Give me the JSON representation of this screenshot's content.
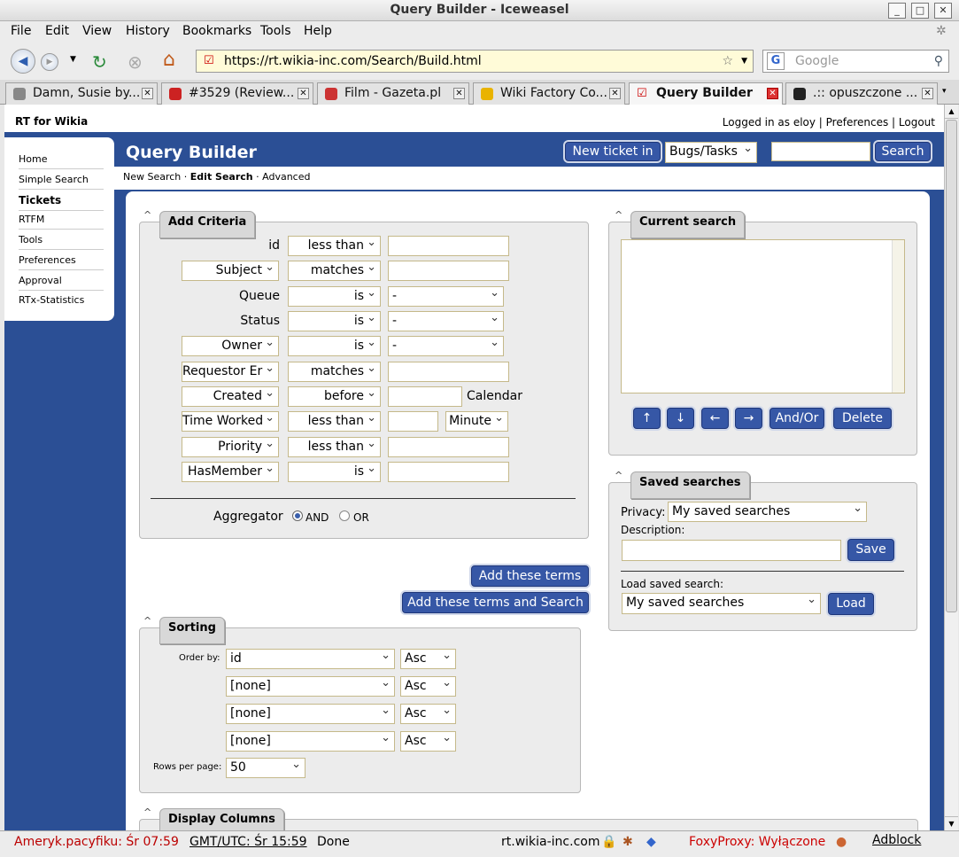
{
  "window": {
    "title": "Query Builder - Iceweasel"
  },
  "menu": [
    "File",
    "Edit",
    "View",
    "History",
    "Bookmarks",
    "Tools",
    "Help"
  ],
  "nav": {
    "url": "https://rt.wikia-inc.com/Search/Build.html",
    "search_placeholder": "Google"
  },
  "tabs": [
    {
      "label": "Damn, Susie by..."
    },
    {
      "label": "#3529 (Review..."
    },
    {
      "label": "Film - Gazeta.pl"
    },
    {
      "label": "Wiki Factory Co..."
    },
    {
      "label": "Query Builder"
    },
    {
      "label": ".:: opuszczone ..."
    }
  ],
  "header": {
    "site": "RT for Wikia",
    "logged_in": "Logged in as eloy",
    "preferences": "Preferences",
    "logout": "Logout",
    "page_title": "Query Builder",
    "new_ticket": "New ticket in",
    "queue_select": "Bugs/Tasks",
    "search_btn": "Search"
  },
  "sidebar": [
    "Home",
    "Simple Search",
    "Tickets",
    "RTFM",
    "Tools",
    "Preferences",
    "Approval",
    "RTx-Statistics"
  ],
  "subnav": {
    "new": "New Search",
    "edit": "Edit Search",
    "advanced": "Advanced"
  },
  "criteria": {
    "title": "Add Criteria",
    "rows": [
      {
        "field": "id",
        "op": "less than",
        "value": ""
      },
      {
        "field": "Subject",
        "op": "matches",
        "value": ""
      },
      {
        "field": "Queue",
        "op": "is",
        "value": "-"
      },
      {
        "field": "Status",
        "op": "is",
        "value": "-"
      },
      {
        "field": "Owner",
        "op": "is",
        "value": "-"
      },
      {
        "field": "Requestor Er",
        "op": "matches",
        "value": ""
      },
      {
        "field": "Created",
        "op": "before",
        "value": "",
        "extra": "Calendar"
      },
      {
        "field": "Time Worked",
        "op": "less than",
        "value": "",
        "extra": "Minute"
      },
      {
        "field": "Priority",
        "op": "less than",
        "value": ""
      },
      {
        "field": "HasMember",
        "op": "is",
        "value": ""
      }
    ],
    "aggregator": "Aggregator",
    "and": "AND",
    "or": "OR",
    "add_terms": "Add these terms",
    "add_terms_search": "Add these terms and Search"
  },
  "current": {
    "title": "Current search",
    "up": "↑",
    "down": "↓",
    "left": "←",
    "right": "→",
    "andor": "And/Or",
    "delete": "Delete"
  },
  "saved": {
    "title": "Saved searches",
    "privacy_label": "Privacy:",
    "privacy": "My saved searches",
    "description": "Description:",
    "save": "Save",
    "load_label": "Load saved search:",
    "load_select": "My saved searches",
    "load": "Load"
  },
  "sorting": {
    "title": "Sorting",
    "order_by": "Order by:",
    "rows": [
      {
        "field": "id",
        "dir": "Asc"
      },
      {
        "field": "[none]",
        "dir": "Asc"
      },
      {
        "field": "[none]",
        "dir": "Asc"
      },
      {
        "field": "[none]",
        "dir": "Asc"
      }
    ],
    "rows_per_page_label": "Rows per page:",
    "rows_per_page": "50"
  },
  "display": {
    "title": "Display Columns"
  },
  "status": {
    "tz1": "Ameryk.pacyfiku: Śr 07:59",
    "tz2": "GMT/UTC: Śr 15:59",
    "done": "Done",
    "host": "rt.wikia-inc.com",
    "foxy": "FoxyProxy: Wyłączone",
    "adblock": "Adblock"
  },
  "colors": {
    "accent": "#2b4f95",
    "button": "#3657a6"
  }
}
